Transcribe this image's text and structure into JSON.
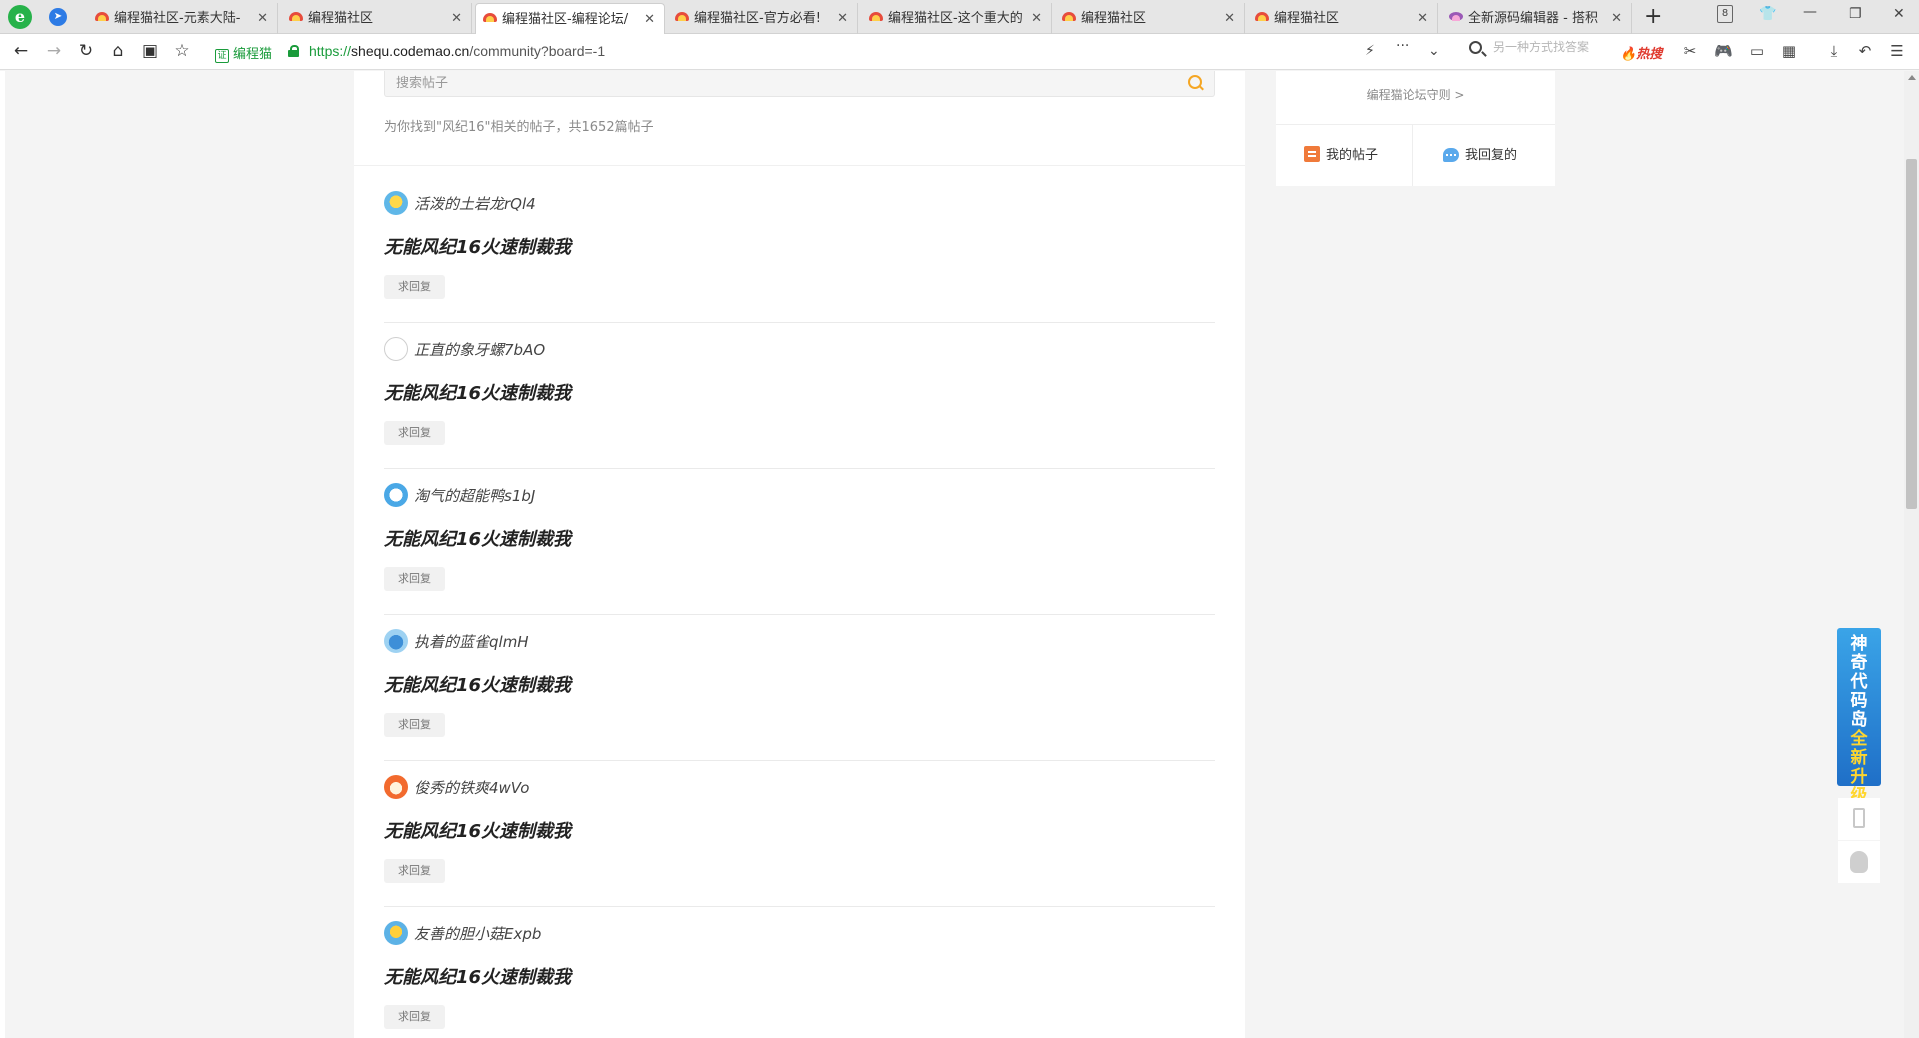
{
  "browser": {
    "tabs": [
      {
        "label": "编程猫社区-元素大陆-",
        "active": false
      },
      {
        "label": "编程猫社区",
        "active": false
      },
      {
        "label": "编程猫社区-编程论坛/",
        "active": true
      },
      {
        "label": "编程猫社区-官方必看!",
        "active": false
      },
      {
        "label": "编程猫社区-这个重大的",
        "active": false
      },
      {
        "label": "编程猫社区",
        "active": false
      },
      {
        "label": "编程猫社区",
        "active": false
      },
      {
        "label": "全新源码编辑器 - 搭积",
        "active": false
      }
    ],
    "tab_close_glyph": "✕",
    "new_tab_glyph": "+",
    "tab_counter": "8",
    "site_name": "编程猫",
    "site_cert_glyph": "证",
    "url_scheme": "https://",
    "url_host": "shequ.codemao.cn",
    "url_path": "/community?board=-1",
    "search_placeholder": "另一种方式找答案",
    "hot_search": "热搜"
  },
  "search": {
    "placeholder": "搜索帖子",
    "result_summary": "为你找到\"风纪16\"相关的帖子，共1652篇帖子"
  },
  "posts": [
    {
      "author": "活泼的土岩龙rQl4",
      "title": "无能风纪16火速制裁我",
      "tag": "求回复"
    },
    {
      "author": "正直的象牙螺7bAO",
      "title": "无能风纪16火速制裁我",
      "tag": "求回复"
    },
    {
      "author": "淘气的超能鸭s1bJ",
      "title": "无能风纪16火速制裁我",
      "tag": "求回复"
    },
    {
      "author": "执着的蓝雀qlmH",
      "title": "无能风纪16火速制裁我",
      "tag": "求回复"
    },
    {
      "author": "俊秀的铁爽4wVo",
      "title": "无能风纪16火速制裁我",
      "tag": "求回复"
    },
    {
      "author": "友善的胆小菇Expb",
      "title": "无能风纪16火速制裁我",
      "tag": "求回复"
    }
  ],
  "sidebar": {
    "rules_link": "编程猫论坛守则 >",
    "my_posts": "我的帖子",
    "my_replies": "我回复的"
  },
  "promo": {
    "lines": [
      "神",
      "奇",
      "代",
      "码",
      "岛"
    ],
    "highlight_lines": [
      "全",
      "新",
      "升",
      "级"
    ]
  },
  "colors": {
    "accent": "#f5a623",
    "secure_green": "#1a9b3b",
    "promo_blue": "#2d8ad8",
    "promo_yellow": "#ffd62e"
  }
}
